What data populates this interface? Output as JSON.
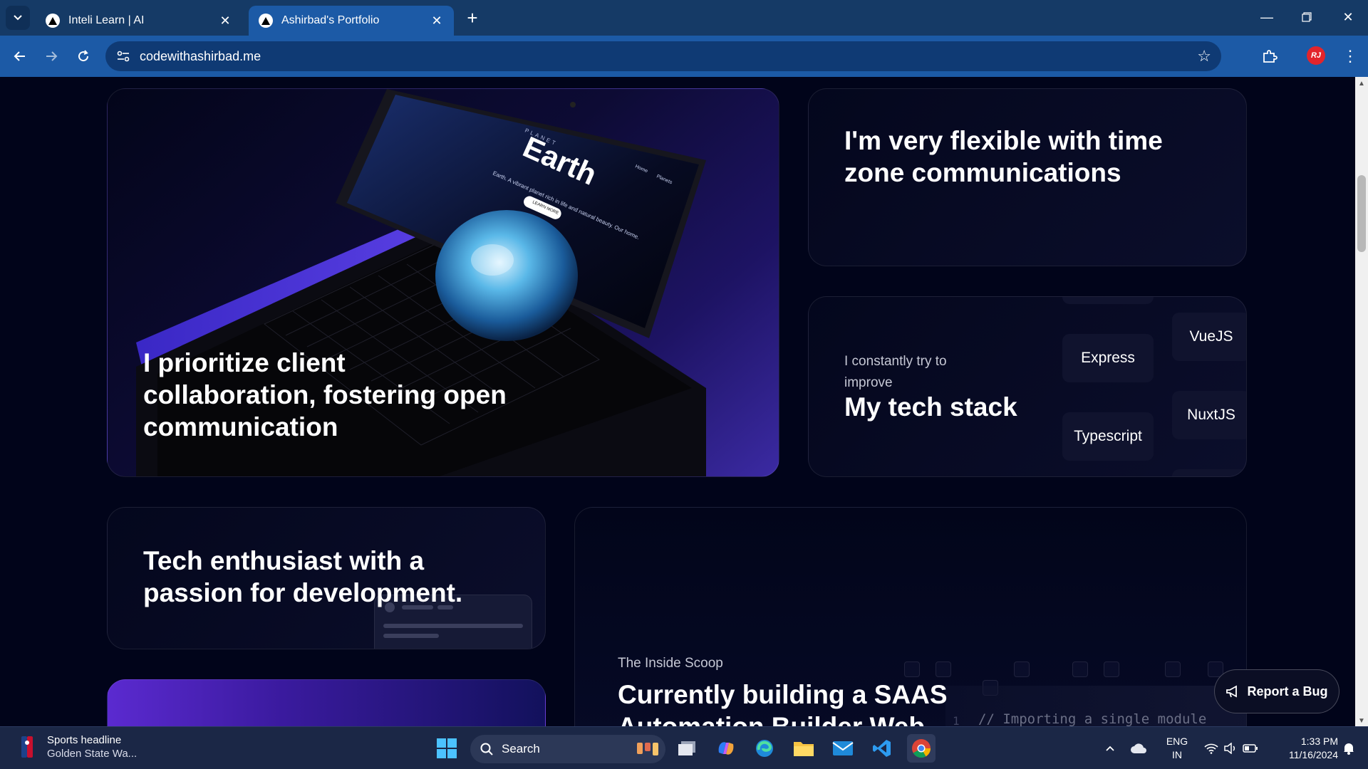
{
  "browser": {
    "tabs": [
      {
        "title": "Inteli Learn | AI",
        "active": false
      },
      {
        "title": "Ashirbad's Portfolio",
        "active": true
      }
    ],
    "url": "codewithashirbad.me",
    "profile_initials": "RJ"
  },
  "page": {
    "card_collab": {
      "heading": "I prioritize client collaboration, fostering open communication",
      "screen_brand": "PLANET",
      "screen_title": "Earth",
      "screen_tagline": "Earth. A vibrant planet rich in life and natural beauty. Our home.",
      "screen_nav": [
        "Home",
        "Planets"
      ],
      "screen_button": "LEARN MORE"
    },
    "card_timezone": {
      "heading": "I'm very flexible with time zone communications"
    },
    "card_techstack": {
      "subtitle": "I constantly try to improve",
      "heading": "My tech stack",
      "chips": [
        "Express",
        "Typescript",
        "VueJS",
        "NuxtJS"
      ]
    },
    "card_enthusiast": {
      "heading": "Tech enthusiast with a passion for development."
    },
    "card_scoop": {
      "subtitle": "The Inside Scoop",
      "heading": "Currently building a SAAS Automation Builder Web",
      "code_line_number": "1",
      "code_comment": "// Importing a single module"
    },
    "report_button": "Report a Bug"
  },
  "taskbar": {
    "news_title": "Sports headline",
    "news_text": "Golden State Wa...",
    "search_label": "Search",
    "lang_1": "ENG",
    "lang_2": "IN",
    "time": "1:33 PM",
    "date": "11/16/2024"
  },
  "colors": {
    "tabbar": "#153a66",
    "toolbar": "#1c5aa6",
    "page_bg": "#01041a",
    "accent_purple": "#3b2aa3"
  }
}
